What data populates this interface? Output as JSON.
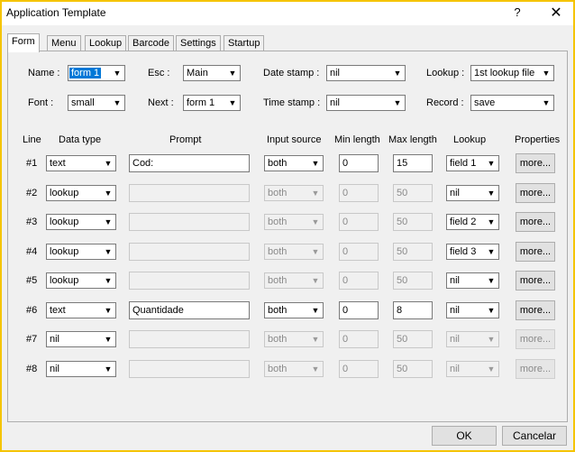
{
  "window": {
    "title": "Application Template",
    "help": "?",
    "close": "✕"
  },
  "tabs": [
    "Form",
    "Menu",
    "Lookup",
    "Barcode",
    "Settings",
    "Startup"
  ],
  "header": {
    "name": {
      "label": "Name :",
      "value": "form 1"
    },
    "esc": {
      "label": "Esc :",
      "value": "Main"
    },
    "date_stamp": {
      "label": "Date stamp :",
      "value": "nil"
    },
    "lookup": {
      "label": "Lookup :",
      "value": "1st lookup file"
    },
    "font": {
      "label": "Font :",
      "value": "small"
    },
    "next": {
      "label": "Next :",
      "value": "form 1"
    },
    "time_stamp": {
      "label": "Time stamp :",
      "value": "nil"
    },
    "record": {
      "label": "Record :",
      "value": "save"
    }
  },
  "columns": {
    "line": "Line",
    "data_type": "Data type",
    "prompt": "Prompt",
    "input_source": "Input source",
    "min_length": "Min length",
    "max_length": "Max length",
    "lookup": "Lookup",
    "properties": "Properties"
  },
  "rows": [
    {
      "line": "#1",
      "data_type": "text",
      "prompt": "Cod:",
      "input_source": "both",
      "min": "0",
      "max": "15",
      "lookup": "field 1",
      "props": "more...",
      "enabled": true,
      "lookup_enabled": true,
      "props_enabled": true
    },
    {
      "line": "#2",
      "data_type": "lookup",
      "prompt": "",
      "input_source": "both",
      "min": "0",
      "max": "50",
      "lookup": "nil",
      "props": "more...",
      "enabled": false,
      "lookup_enabled": true,
      "props_enabled": true
    },
    {
      "line": "#3",
      "data_type": "lookup",
      "prompt": "",
      "input_source": "both",
      "min": "0",
      "max": "50",
      "lookup": "field 2",
      "props": "more...",
      "enabled": false,
      "lookup_enabled": true,
      "props_enabled": true
    },
    {
      "line": "#4",
      "data_type": "lookup",
      "prompt": "",
      "input_source": "both",
      "min": "0",
      "max": "50",
      "lookup": "field 3",
      "props": "more...",
      "enabled": false,
      "lookup_enabled": true,
      "props_enabled": true
    },
    {
      "line": "#5",
      "data_type": "lookup",
      "prompt": "",
      "input_source": "both",
      "min": "0",
      "max": "50",
      "lookup": "nil",
      "props": "more...",
      "enabled": false,
      "lookup_enabled": true,
      "props_enabled": true
    },
    {
      "line": "#6",
      "data_type": "text",
      "prompt": "Quantidade",
      "input_source": "both",
      "min": "0",
      "max": "8",
      "lookup": "nil",
      "props": "more...",
      "enabled": true,
      "lookup_enabled": true,
      "props_enabled": true
    },
    {
      "line": "#7",
      "data_type": "nil",
      "prompt": "",
      "input_source": "both",
      "min": "0",
      "max": "50",
      "lookup": "nil",
      "props": "more...",
      "enabled": false,
      "lookup_enabled": false,
      "props_enabled": false
    },
    {
      "line": "#8",
      "data_type": "nil",
      "prompt": "",
      "input_source": "both",
      "min": "0",
      "max": "50",
      "lookup": "nil",
      "props": "more...",
      "enabled": false,
      "lookup_enabled": false,
      "props_enabled": false
    }
  ],
  "footer": {
    "ok": "OK",
    "cancel": "Cancelar"
  },
  "icons": {
    "dropdown": "▼"
  }
}
